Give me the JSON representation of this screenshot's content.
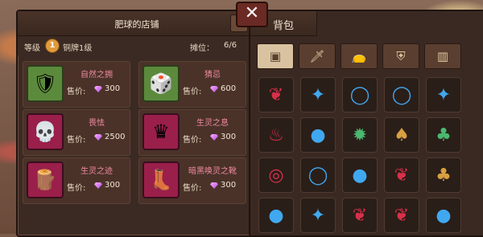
{
  "shop": {
    "title": "肥球的店铺",
    "level_label": "等级",
    "level_value": "1",
    "rank": "铜牌1级",
    "slots_label": "摊位：",
    "slots_value": "6/6",
    "edit_icon": "pen-icon",
    "items": [
      {
        "name": "自然之拥",
        "price_label": "售价:",
        "price": "300",
        "icon": "green-armor"
      },
      {
        "name": "猜忌",
        "price_label": "售价:",
        "price": "600",
        "icon": "green-dice"
      },
      {
        "name": "畏怯",
        "price_label": "售价:",
        "price": "2500",
        "icon": "skull-ring"
      },
      {
        "name": "生灵之息",
        "price_label": "售价:",
        "price": "300",
        "icon": "dark-crown"
      },
      {
        "name": "生灵之迹",
        "price_label": "售价:",
        "price": "300",
        "icon": "wood-claw"
      },
      {
        "name": "暗黑唤灵之靴",
        "price_label": "售价:",
        "price": "300",
        "icon": "dark-boot"
      }
    ]
  },
  "bag": {
    "title": "背包",
    "close_icon": "close-icon",
    "tabs": [
      "all-tab-icon",
      "weapon-tab-icon",
      "bag-tab-icon",
      "armor-tab-icon",
      "material-tab-icon"
    ],
    "grid": [
      [
        "❦",
        "✦",
        "◯",
        "◯",
        "✦"
      ],
      [
        "♨",
        "●",
        "✹",
        "♠",
        "♣"
      ],
      [
        "◎",
        "◯",
        "●",
        "❦",
        "♣"
      ],
      [
        "●",
        "✦",
        "❦",
        "❦",
        "●"
      ]
    ],
    "grid_colors": [
      [
        "#d8304a",
        "#40a8f0",
        "#40a8f0",
        "#40a8f0",
        "#40a8f0"
      ],
      [
        "#d8304a",
        "#40a8f0",
        "#4ab870",
        "#d8a040",
        "#4ab870"
      ],
      [
        "#d8304a",
        "#40a8f0",
        "#40a8f0",
        "#d8304a",
        "#d8a040"
      ],
      [
        "#40a8f0",
        "#40a8f0",
        "#d8304a",
        "#d8304a",
        "#40a8f0"
      ]
    ]
  }
}
